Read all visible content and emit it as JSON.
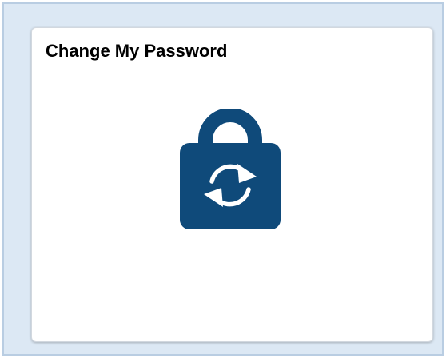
{
  "tile": {
    "title": "Change My Password",
    "icon": "lock-refresh-icon",
    "icon_color": "#0f4a7a",
    "background_color": "#dce8f4"
  }
}
